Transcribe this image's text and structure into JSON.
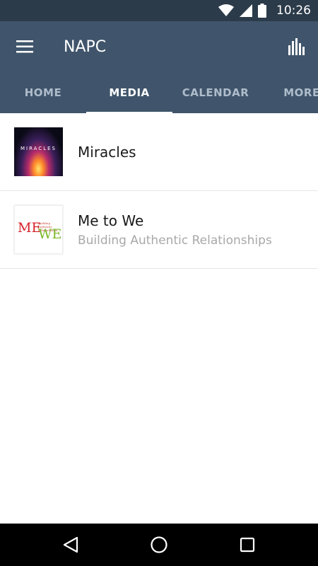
{
  "status_bar": {
    "time": "10:26",
    "icons": [
      "wifi-icon",
      "cell-signal-icon",
      "battery-icon"
    ]
  },
  "app_bar": {
    "title": "NAPC",
    "menu_icon": "hamburger-menu-icon",
    "action_icon": "bar-chart-icon"
  },
  "tabs": [
    {
      "label": "HOME",
      "active": false
    },
    {
      "label": "MEDIA",
      "active": true
    },
    {
      "label": "CALENDAR",
      "active": false
    },
    {
      "label": "MORE",
      "active": false
    }
  ],
  "media_list": [
    {
      "title": "Miracles",
      "subtitle": "",
      "thumbnail_text": "MIRACLES"
    },
    {
      "title": "Me to We",
      "subtitle": "Building Authentic Relationships",
      "thumbnail_text": {
        "me": "ME",
        "we": "WE",
        "tagline": "Building Authentic Relationships"
      }
    }
  ],
  "nav_bar": {
    "icons": [
      "back-icon",
      "home-icon",
      "recents-icon"
    ]
  },
  "colors": {
    "status_bar": "#2c3b4a",
    "app_bar": "#40556b",
    "tab_inactive": "#aebccb",
    "tab_active": "#ffffff"
  }
}
